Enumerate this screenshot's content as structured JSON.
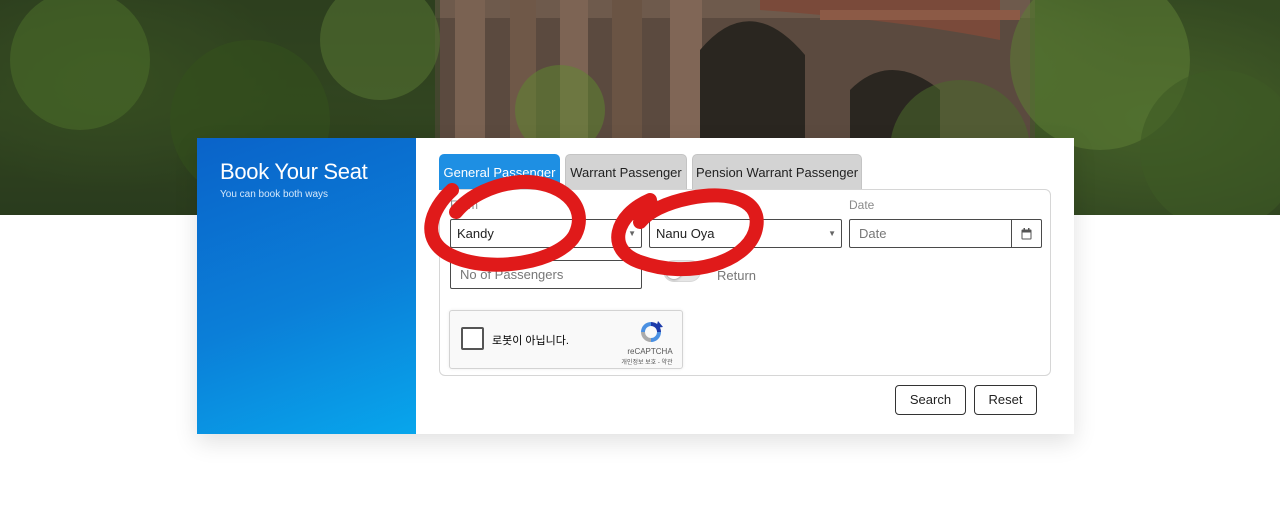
{
  "booking": {
    "title": "Book Your Seat",
    "subtitle": "You can book both ways"
  },
  "tabs": [
    {
      "label": "General Passenger",
      "active": true
    },
    {
      "label": "Warrant Passenger",
      "active": false
    },
    {
      "label": "Pension Warrant Passenger",
      "active": false
    }
  ],
  "form": {
    "from_label": "From",
    "from_value": "Kandy",
    "to_label": "To",
    "to_value": "Nanu Oya",
    "date_label": "Date",
    "date_placeholder": "Date",
    "passengers_placeholder": "No of Passengers",
    "return_label": "Return",
    "return_enabled": false
  },
  "recaptcha": {
    "label": "로봇이 아닙니다.",
    "brand": "reCAPTCHA",
    "terms": "개인정보 보호 - 약관"
  },
  "actions": {
    "search_label": "Search",
    "reset_label": "Reset"
  },
  "colors": {
    "accent": "#1e8fe3",
    "panel_gradient_top": "#0a63c9",
    "panel_gradient_bottom": "#08a6ec",
    "annotation_red": "#e01a1a"
  }
}
